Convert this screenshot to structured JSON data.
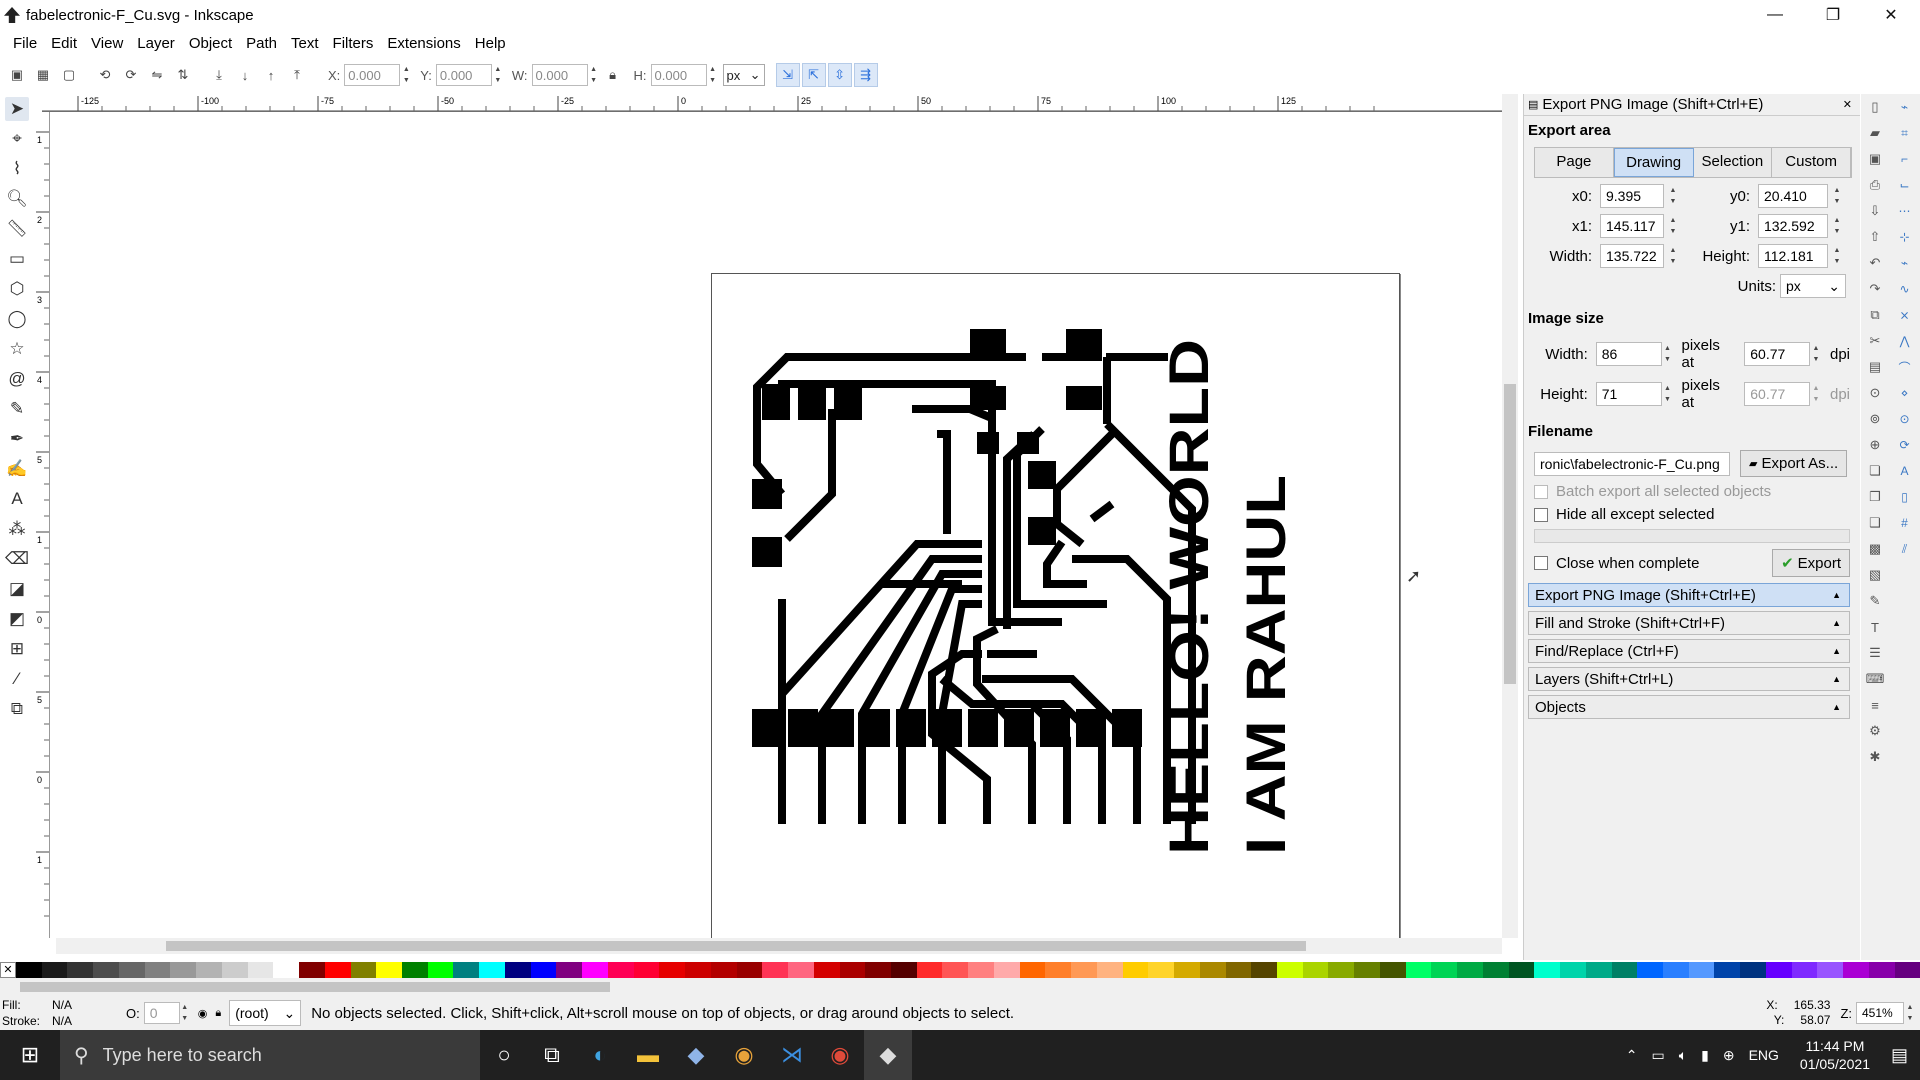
{
  "window": {
    "title": "fabelectronic-F_Cu.svg - Inkscape"
  },
  "menu": [
    "File",
    "Edit",
    "View",
    "Layer",
    "Object",
    "Path",
    "Text",
    "Filters",
    "Extensions",
    "Help"
  ],
  "toolbar": {
    "x_label": "X:",
    "x": "0.000",
    "y_label": "Y:",
    "y": "0.000",
    "w_label": "W:",
    "w": "0.000",
    "h_label": "H:",
    "h": "0.000",
    "unit": "px"
  },
  "ruler": {
    "h_ticks": [
      "-125",
      "-100",
      "-75",
      "-50",
      "-25",
      "0",
      "25",
      "50",
      "75",
      "100",
      "125"
    ],
    "v_ticks": [
      "1",
      "2",
      "3",
      "4",
      "5",
      "1",
      "0",
      "5",
      "0",
      "1"
    ]
  },
  "canvas": {
    "text_line1": "HELLO! WORLD",
    "text_line2": "I AM RAHUL"
  },
  "panel": {
    "title": "Export PNG Image (Shift+Ctrl+E)",
    "export_area": "Export area",
    "area_buttons": [
      "Page",
      "Drawing",
      "Selection",
      "Custom"
    ],
    "x0_label": "x0:",
    "x0": "9.395",
    "y0_label": "y0:",
    "y0": "20.410",
    "x1_label": "x1:",
    "x1": "145.117",
    "y1_label": "y1:",
    "y1": "132.592",
    "width_label": "Width:",
    "width": "135.722",
    "height_label": "Height:",
    "height": "112.181",
    "units_label": "Units:",
    "units": "px",
    "image_size": "Image size",
    "img_width": "86",
    "img_height": "71",
    "pixels_at": "pixels at",
    "dpi": "60.77",
    "dpi2": "60.77",
    "dpi_unit": "dpi",
    "filename_label": "Filename",
    "filename": "ronic\\fabelectronic-F_Cu.png",
    "export_as": "Export As...",
    "batch": "Batch export all selected objects",
    "hide": "Hide all except selected",
    "close": "Close when complete",
    "export": "Export",
    "docks": [
      "Export PNG Image (Shift+Ctrl+E)",
      "Fill and Stroke (Shift+Ctrl+F)",
      "Find/Replace (Ctrl+F)",
      "Layers (Shift+Ctrl+L)",
      "Objects"
    ]
  },
  "status": {
    "fill_label": "Fill:",
    "fill": "N/A",
    "stroke_label": "Stroke:",
    "stroke": "N/A",
    "opacity_label": "O:",
    "opacity": "0",
    "layer": "(root)",
    "message": "No objects selected. Click, Shift+click, Alt+scroll mouse on top of objects, or drag around objects to select.",
    "x_label": "X:",
    "x": "165.33",
    "y_label": "Y:",
    "y": "58.07",
    "z_label": "Z:",
    "zoom": "451%"
  },
  "taskbar": {
    "search": "Type here to search",
    "lang": "ENG",
    "time": "11:44 PM",
    "date": "01/05/2021"
  },
  "palette": [
    "#000000",
    "#1a1a1a",
    "#333333",
    "#4d4d4d",
    "#666666",
    "#808080",
    "#999999",
    "#b3b3b3",
    "#cccccc",
    "#e6e6e6",
    "#ffffff",
    "#800000",
    "#ff0000",
    "#808000",
    "#ffff00",
    "#008000",
    "#00ff00",
    "#008080",
    "#00ffff",
    "#000080",
    "#0000ff",
    "#800080",
    "#ff00ff",
    "#ff0055",
    "#ff0033",
    "#e60000",
    "#cc0000",
    "#b30000",
    "#990000",
    "#ff3355",
    "#ff6680",
    "#d40000",
    "#aa0000",
    "#800000",
    "#550000",
    "#ff2a2a",
    "#ff5555",
    "#ff8080",
    "#ffaaaa",
    "#ff6600",
    "#ff7f2a",
    "#ff9955",
    "#ffb380",
    "#ffcc00",
    "#ffd42a",
    "#d4aa00",
    "#aa8800",
    "#806600",
    "#554400",
    "#ccff00",
    "#aad400",
    "#88aa00",
    "#668000",
    "#445500",
    "#00ff66",
    "#00d455",
    "#00aa44",
    "#008033",
    "#005522",
    "#00ffcc",
    "#00d4aa",
    "#00aa88",
    "#008066",
    "#0066ff",
    "#2a7fff",
    "#5599ff",
    "#0044aa",
    "#003380",
    "#6600ff",
    "#7f2aff",
    "#9955ff",
    "#aa00d4",
    "#8800aa",
    "#660080"
  ]
}
